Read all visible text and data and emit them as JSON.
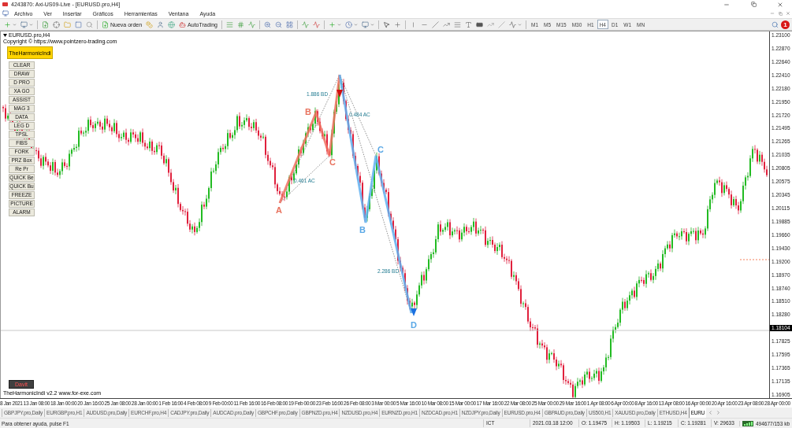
{
  "window": {
    "title": "4243870: Axi-US09-Live - [EURUSD.pro,H4]"
  },
  "menu": [
    "Archivo",
    "Ver",
    "Insertar",
    "Gráficos",
    "Herramientas",
    "Ventana",
    "Ayuda"
  ],
  "toolbar": {
    "new_order": "Nueva orden",
    "autotrading": "AutoTrading",
    "notification_count": "1",
    "timeframes": [
      {
        "label": "M1",
        "selected": false
      },
      {
        "label": "M5",
        "selected": false
      },
      {
        "label": "M15",
        "selected": false
      },
      {
        "label": "M30",
        "selected": false
      },
      {
        "label": "H1",
        "selected": false
      },
      {
        "label": "H4",
        "selected": true
      },
      {
        "label": "D1",
        "selected": false
      },
      {
        "label": "W1",
        "selected": false
      },
      {
        "label": "MN",
        "selected": false
      }
    ]
  },
  "chart": {
    "symbol": "EURUSD.pro,H4",
    "copyright": "Copyright © https://www.pointzero-trading.com",
    "indicator_button": "TheHarmonicIndi",
    "panel_buttons": [
      "CLEAR",
      "DRAW",
      "D PRO",
      "XA GO",
      "ASSIST",
      "MAG 3",
      "DATA",
      "LEG D",
      "TPSL",
      "FIBS",
      "FORK",
      "PRZ Box",
      "Re Pr",
      "QUICK Be",
      "QUICK Bu",
      "FREEZE",
      "PICTURE",
      "ALARM"
    ],
    "user_button": "Davit",
    "footer": "TheHarmonicIndi v2.2 www.for-exe.com",
    "pattern_labels": [
      {
        "text": "A",
        "color": "#e8735f"
      },
      {
        "text": "B",
        "color": "#e8735f"
      },
      {
        "text": "C",
        "color": "#e8735f"
      },
      {
        "text": "B",
        "color": "#5aa8e6"
      },
      {
        "text": "C",
        "color": "#5aa8e6"
      },
      {
        "text": "D",
        "color": "#5aa8e6"
      }
    ],
    "ratio_labels": [
      "1.886 BD",
      "0.484 AC",
      "0.461 AC",
      "2.286 BD"
    ],
    "price_ticks": [
      {
        "label": "1.23100",
        "kind": "tick"
      },
      {
        "label": "1.22870",
        "kind": "tick"
      },
      {
        "label": "1.22640",
        "kind": "tick"
      },
      {
        "label": "1.22410",
        "kind": "tick"
      },
      {
        "label": "1.22180",
        "kind": "tick"
      },
      {
        "label": "1.21950",
        "kind": "tick"
      },
      {
        "label": "1.21720",
        "kind": "tick"
      },
      {
        "label": "1.21495",
        "kind": "tick"
      },
      {
        "label": "1.21265",
        "kind": "tick"
      },
      {
        "label": "1.21035",
        "kind": "tick"
      },
      {
        "label": "1.20805",
        "kind": "tick"
      },
      {
        "label": "1.20575",
        "kind": "tick"
      },
      {
        "label": "1.20345",
        "kind": "tick"
      },
      {
        "label": "1.20115",
        "kind": "tick"
      },
      {
        "label": "1.19885",
        "kind": "tick"
      },
      {
        "label": "1.19660",
        "kind": "tick"
      },
      {
        "label": "1.19430",
        "kind": "tick"
      },
      {
        "label": "1.19200",
        "kind": "tick"
      },
      {
        "label": "1.18970",
        "kind": "tick"
      },
      {
        "label": "1.18740",
        "kind": "tick"
      },
      {
        "label": "1.18510",
        "kind": "tick"
      },
      {
        "label": "1.18280",
        "kind": "tick"
      },
      {
        "label": "1.18104",
        "kind": "current"
      },
      {
        "label": "1.17825",
        "kind": "tick"
      },
      {
        "label": "1.17595",
        "kind": "tick"
      },
      {
        "label": "1.17365",
        "kind": "tick"
      },
      {
        "label": "1.17135",
        "kind": "tick"
      },
      {
        "label": "1.16905",
        "kind": "tick"
      }
    ],
    "time_labels": [
      "8 Jan 2021",
      "13 Jan 08:00",
      "18 Jan 00:00",
      "20 Jan 16:00",
      "25 Jan 08:00",
      "28 Jan 00:00",
      "1 Feb 16:00",
      "4 Feb 08:00",
      "9 Feb 00:00",
      "11 Feb 16:00",
      "16 Feb 08:00",
      "19 Feb 00:00",
      "23 Feb 16:00",
      "26 Feb 08:00",
      "3 Mar 00:00",
      "5 Mar 16:00",
      "10 Mar 08:00",
      "15 Mar 00:00",
      "17 Mar 16:00",
      "22 Mar 08:00",
      "25 Mar 00:00",
      "29 Mar 16:00",
      "1 Apr 08:00",
      "6 Apr 00:00",
      "8 Apr 16:00",
      "13 Apr 08:00",
      "16 Apr 00:00",
      "20 Apr 16:00",
      "23 Apr 08:00",
      "28 Apr 00:00"
    ]
  },
  "tabs": [
    {
      "label": "GBPJPY.pro,Daily",
      "selected": false
    },
    {
      "label": "EURGBP.pro,H1",
      "selected": false
    },
    {
      "label": "AUDUSD.pro,Daily",
      "selected": false
    },
    {
      "label": "EURCHF.pro,H4",
      "selected": false
    },
    {
      "label": "CADJPY.pro,Daily",
      "selected": false
    },
    {
      "label": "AUDCAD.pro,Daily",
      "selected": false
    },
    {
      "label": "GBPCHF.pro,Daily",
      "selected": false
    },
    {
      "label": "GBPNZD.pro,H4",
      "selected": false
    },
    {
      "label": "NZDUSD.pro,H4",
      "selected": false
    },
    {
      "label": "EURNZD.pro,H1",
      "selected": false
    },
    {
      "label": "NZDCAD.pro,H1",
      "selected": false
    },
    {
      "label": "NZDJPY.pro,Daily",
      "selected": false
    },
    {
      "label": "EURUSD.pro,H4",
      "selected": false
    },
    {
      "label": "GBPAUD.pro,Daily",
      "selected": false
    },
    {
      "label": "US500,H1",
      "selected": false
    },
    {
      "label": "XAUUSD.pro,Daily",
      "selected": false
    },
    {
      "label": "ETHUSD,H4",
      "selected": false
    },
    {
      "label": "EURU",
      "selected": true
    }
  ],
  "status_bar": {
    "help": "Para obtener ayuda, pulse F1",
    "profile": "ICT",
    "datetime": "2021.03.18 12:00",
    "open": "O: 1.19475",
    "high": "H: 1.19503",
    "low": "L: 1.19215",
    "close": "C: 1.19281",
    "volume": "V: 29633",
    "traffic": "494677/153 kb"
  }
}
